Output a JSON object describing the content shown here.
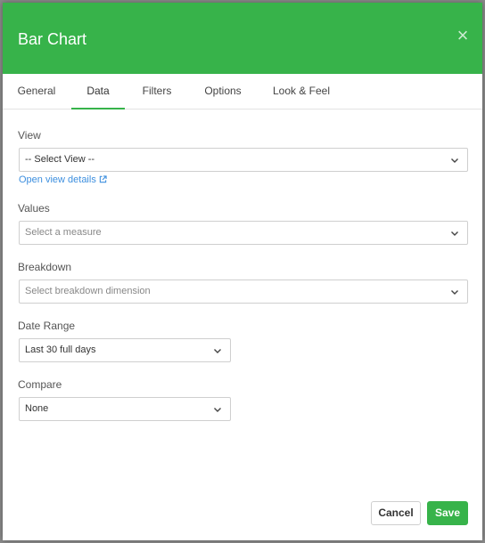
{
  "dialog": {
    "title": "Bar Chart",
    "close_symbol": "×"
  },
  "tabs": [
    {
      "label": "General",
      "active": false
    },
    {
      "label": "Data",
      "active": true
    },
    {
      "label": "Filters",
      "active": false
    },
    {
      "label": "Options",
      "active": false
    },
    {
      "label": "Look & Feel",
      "active": false
    }
  ],
  "fields": {
    "view": {
      "label": "View",
      "value": "-- Select View --"
    },
    "view_link": "Open view details",
    "values": {
      "label": "Values",
      "placeholder": "Select a measure"
    },
    "breakdown": {
      "label": "Breakdown",
      "placeholder": "Select breakdown dimension"
    },
    "date_range": {
      "label": "Date Range",
      "value": "Last 30 full days"
    },
    "compare": {
      "label": "Compare",
      "value": "None"
    }
  },
  "footer": {
    "cancel_label": "Cancel",
    "save_label": "Save"
  },
  "colors": {
    "accent": "#37b34a",
    "link": "#3d8fdf"
  }
}
